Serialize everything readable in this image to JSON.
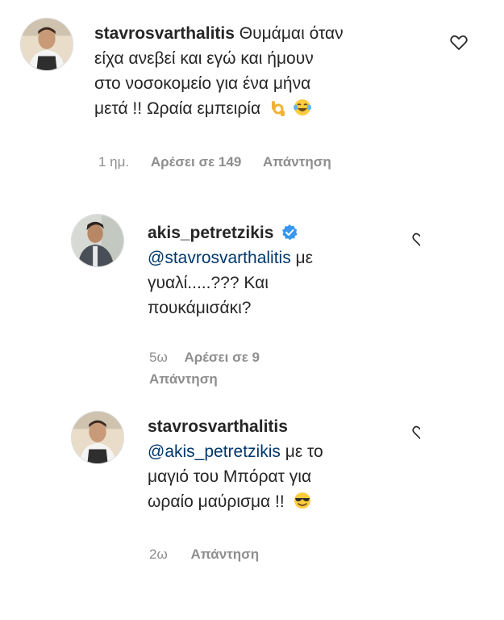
{
  "comments": [
    {
      "username": "stavrosvarthalitis",
      "mention": "",
      "lines": [
        "Θυμάμαι όταν",
        "είχα ανεβεί και εγώ και ήμουν",
        "στο νοσοκομείο για ένα μήνα",
        "μετά !! Ωραία εμπειρία"
      ],
      "emojis": [
        "ok-hand-emoji",
        "tears-of-joy-emoji"
      ],
      "time": "1 ημ.",
      "likes": "Αρέσει σε 149",
      "reply": "Απάντηση",
      "verified": false
    },
    {
      "username": "akis_petretzikis",
      "mention": "@stavrosvarthalitis",
      "lines": [
        "με",
        "γυαλί.....??? Και",
        "πουκάμισάκι?"
      ],
      "emojis": [],
      "time": "5ω",
      "likes": "Αρέσει σε 9",
      "reply": "Απάντηση",
      "verified": true
    },
    {
      "username": "stavrosvarthalitis",
      "mention": "@akis_petretzikis",
      "lines": [
        "με το",
        "μαγιό του Μπόρατ για",
        "ωραίο μαύρισμα !!"
      ],
      "emojis": [
        "sunglasses-emoji"
      ],
      "time": "2ω",
      "likes": "",
      "reply": "Απάντηση",
      "verified": false
    }
  ],
  "icons": {
    "like": "heart-outline-icon",
    "verified": "verified-badge-icon"
  },
  "colors": {
    "text": "#262626",
    "muted": "#8e8e8e",
    "mention": "#00376b",
    "verified": "#3897f0"
  }
}
